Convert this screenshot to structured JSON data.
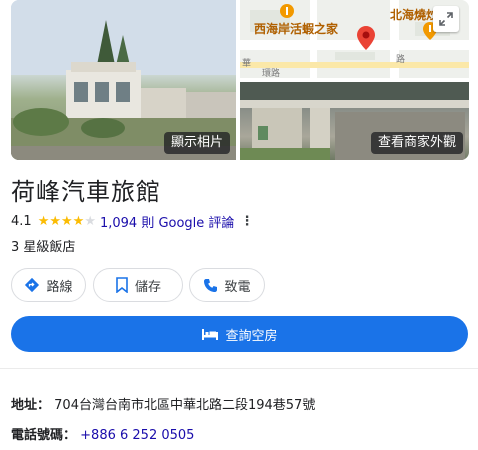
{
  "photos": {
    "main_label": "顯示相片",
    "storefront_label": "查看商家外觀",
    "map": {
      "poi_1": "西海岸活蝦之家",
      "poi_2": "北海燒炒",
      "street_1": "華",
      "street_2": "路",
      "street_3": "環路"
    }
  },
  "place": {
    "name": "荷峰汽車旅館",
    "rating": "4.1",
    "rating_value": 4.1,
    "stars_total": 5,
    "reviews": "1,094 則 Google 評論",
    "category": "3 星級飯店"
  },
  "actions": {
    "directions": "路線",
    "save": "儲存",
    "call": "致電"
  },
  "book": {
    "label": "查詢空房"
  },
  "info": {
    "address_label": "地址：",
    "address_value": "704台灣台南市北區中華北路二段194巷57號",
    "phone_label": "電話號碼：",
    "phone_value": "+886 6 252 0505"
  },
  "colors": {
    "accent": "#1a73e8",
    "star": "#fbbc04",
    "link": "#1a0dab",
    "pin": "#ea4335",
    "poi": "#f29900"
  }
}
